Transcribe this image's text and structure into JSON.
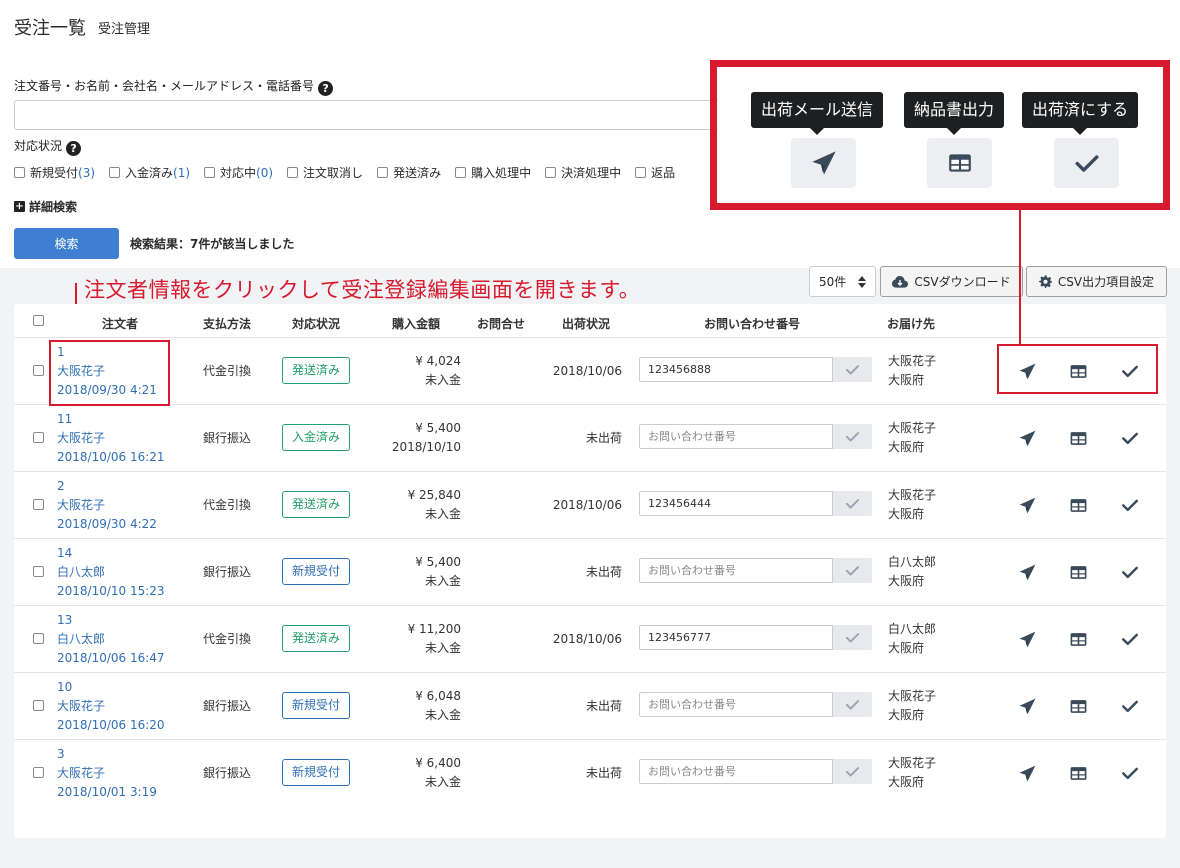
{
  "header": {
    "title": "受注一覧",
    "subtitle": "受注管理"
  },
  "search": {
    "multi_label": "注文番号・お名前・会社名・メールアドレス・電話番号",
    "input_value": "",
    "status_label": "対応状況",
    "statuses": [
      {
        "label": "新規受付",
        "count": "(3)"
      },
      {
        "label": "入金済み",
        "count": "(1)"
      },
      {
        "label": "対応中",
        "count": "(0)"
      },
      {
        "label": "注文取消し",
        "count": ""
      },
      {
        "label": "発送済み",
        "count": ""
      },
      {
        "label": "購入処理中",
        "count": ""
      },
      {
        "label": "決済処理中",
        "count": ""
      },
      {
        "label": "返品",
        "count": ""
      }
    ],
    "advanced_label": "詳細検索",
    "search_button": "検索",
    "result_text": "検索結果：7件が該当しました"
  },
  "annotation": {
    "text": "注文者情報をクリックして受注登録編集画面を開きます。"
  },
  "toolbar": {
    "per_page": "50件",
    "csv_download": "CSVダウンロード",
    "csv_settings": "CSV出力項目設定"
  },
  "table": {
    "headers": {
      "orderer": "注文者",
      "payment": "支払方法",
      "status": "対応状況",
      "amount": "購入金額",
      "inquiry": "お問合せ",
      "shipping": "出荷状況",
      "tracking": "お問い合わせ番号",
      "destination": "お届け先"
    },
    "tracking_placeholder": "お問い合わせ番号",
    "rows": [
      {
        "id": "1",
        "name": "大阪花子",
        "date": "2018/09/30 4:21",
        "payment": "代金引換",
        "status": "発送済み",
        "status_color": "green",
        "amount": "¥ 4,024",
        "payment_status": "未入金",
        "shipping": "2018/10/06",
        "tracking": "123456888",
        "dest_name": "大阪花子",
        "dest_pref": "大阪府"
      },
      {
        "id": "11",
        "name": "大阪花子",
        "date": "2018/10/06 16:21",
        "payment": "銀行振込",
        "status": "入金済み",
        "status_color": "green",
        "amount": "¥ 5,400",
        "payment_status": "2018/10/10",
        "shipping": "未出荷",
        "tracking": "",
        "dest_name": "大阪花子",
        "dest_pref": "大阪府"
      },
      {
        "id": "2",
        "name": "大阪花子",
        "date": "2018/09/30 4:22",
        "payment": "代金引換",
        "status": "発送済み",
        "status_color": "green",
        "amount": "¥ 25,840",
        "payment_status": "未入金",
        "shipping": "2018/10/06",
        "tracking": "123456444",
        "dest_name": "大阪花子",
        "dest_pref": "大阪府"
      },
      {
        "id": "14",
        "name": "白八太郎",
        "date": "2018/10/10 15:23",
        "payment": "銀行振込",
        "status": "新規受付",
        "status_color": "blue",
        "amount": "¥ 5,400",
        "payment_status": "未入金",
        "shipping": "未出荷",
        "tracking": "",
        "dest_name": "白八太郎",
        "dest_pref": "大阪府"
      },
      {
        "id": "13",
        "name": "白八太郎",
        "date": "2018/10/06 16:47",
        "payment": "代金引換",
        "status": "発送済み",
        "status_color": "green",
        "amount": "¥ 11,200",
        "payment_status": "未入金",
        "shipping": "2018/10/06",
        "tracking": "123456777",
        "dest_name": "白八太郎",
        "dest_pref": "大阪府"
      },
      {
        "id": "10",
        "name": "大阪花子",
        "date": "2018/10/06 16:20",
        "payment": "銀行振込",
        "status": "新規受付",
        "status_color": "blue",
        "amount": "¥ 6,048",
        "payment_status": "未入金",
        "shipping": "未出荷",
        "tracking": "",
        "dest_name": "大阪花子",
        "dest_pref": "大阪府"
      },
      {
        "id": "3",
        "name": "大阪花子",
        "date": "2018/10/01 3:19",
        "payment": "銀行振込",
        "status": "新規受付",
        "status_color": "blue",
        "amount": "¥ 6,400",
        "payment_status": "未入金",
        "shipping": "未出荷",
        "tracking": "",
        "dest_name": "大阪花子",
        "dest_pref": "大阪府"
      }
    ]
  },
  "tooltips": {
    "send_mail": "出荷メール送信",
    "delivery_note": "納品書出力",
    "mark_shipped": "出荷済にする"
  },
  "icons": {
    "send": "paper-plane-icon",
    "note": "table-icon",
    "check": "check-icon",
    "download": "cloud-download-icon",
    "settings": "gear-icon"
  },
  "colors": {
    "primary": "#3e7fd1",
    "link": "#2f6fb7",
    "green": "#22a06b",
    "annotation_red": "#d71a2e",
    "icon": "#3b4a5a"
  }
}
